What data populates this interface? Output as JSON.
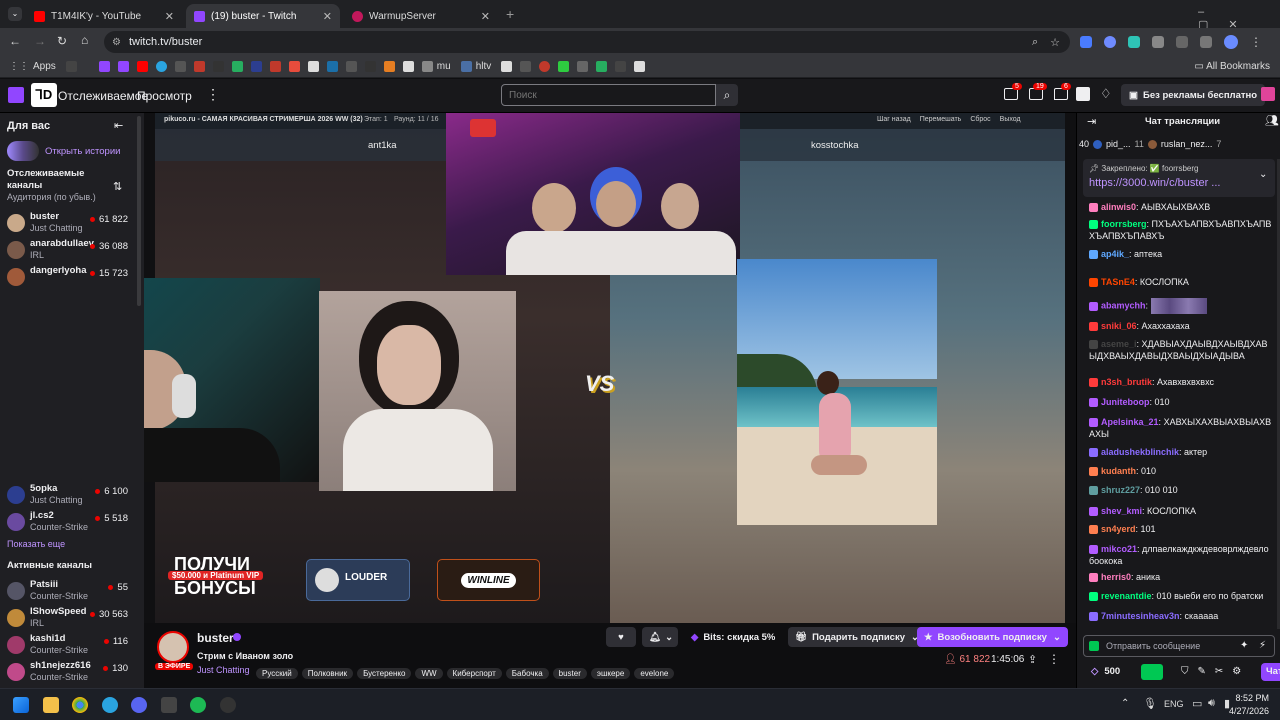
{
  "browser": {
    "tabs": [
      {
        "title": "T1M4IK'у - YouTube",
        "color": "#ff0000"
      },
      {
        "title": "(19) buster - Twitch",
        "color": "#9146ff"
      },
      {
        "title": "WarmupServer",
        "color": "#c2185b"
      }
    ],
    "url": "twitch.tv/buster",
    "bookmarks": {
      "apps": "Apps",
      "mu": "mu",
      "hltv": "hltv",
      "all": "All Bookmarks"
    }
  },
  "twitch_nav": {
    "following": "Отслеживаемое",
    "browse": "Просмотр",
    "search_placeholder": "Поиск",
    "badges": {
      "inbox": "5",
      "whispers": "19",
      "notif": "6"
    },
    "turbo": "Без рекламы бесплатно"
  },
  "sidebar": {
    "for_you": "Для вас",
    "open_stories": "Открыть истории",
    "followed_title": "Отслеживаемые каналы",
    "followed_sort": "Аудитория (по убыв.)",
    "followed": [
      {
        "name": "buster",
        "game": "Just Chatting",
        "viewers": "61 822"
      },
      {
        "name": "anarabdullaev",
        "game": "IRL",
        "viewers": "36 088"
      },
      {
        "name": "dangerlyoha",
        "game": "",
        "viewers": "15 723"
      },
      {
        "name": "5opka",
        "game": "Just Chatting",
        "viewers": "6 100"
      },
      {
        "name": "jl.cs2",
        "game": "Counter-Strike",
        "viewers": "5 518"
      }
    ],
    "show_more": "Показать еще",
    "active_title": "Активные каналы",
    "active": [
      {
        "name": "Patsiii",
        "game": "Counter-Strike",
        "viewers": "55"
      },
      {
        "name": "IShowSpeed",
        "game": "IRL",
        "viewers": "30 563"
      },
      {
        "name": "kashi1d",
        "game": "Counter-Strike",
        "viewers": "116"
      },
      {
        "name": "sh1nejezz616",
        "game": "Counter-Strike",
        "viewers": "130"
      }
    ]
  },
  "video": {
    "site_title": "pikuco.ru - САМАЯ КРАСИВАЯ СТРИМЕРША 2026 WW (32)",
    "stage": "Этап: 1",
    "round": "Раунд: 11 / 16",
    "controls": [
      "Шаг назад",
      "Перемешать",
      "Сброс",
      "Выход"
    ],
    "left_name": "ant1ka",
    "right_name": "kosstochka",
    "vs": "VS",
    "promo_line1": "ПОЛУЧИ",
    "promo_badge": "$50.000 и Platinum VIP",
    "promo_line2": "БОНУСЫ",
    "ad_louder": "LOUDER",
    "ad_winline": "WINLINE"
  },
  "stream_info": {
    "channel": "buster",
    "title": "Стрим с Иваном золо",
    "live": "В ЭФИРЕ",
    "category": "Just Chatting",
    "tags": [
      "Русский",
      "Полковник",
      "Бустеренко",
      "WW",
      "Киберспорт",
      "Бабочка",
      "buster",
      "эшкере",
      "evelone"
    ],
    "viewers": "61 822",
    "uptime": "1:45:06",
    "bits": "Bits: скидка 5%",
    "subscribe": "Подарить подписку",
    "resub": "Возобновить подписку"
  },
  "chat": {
    "header": "Чат трансляции",
    "top_count": "40",
    "gifters": [
      {
        "name": "pid_...",
        "count": "11"
      },
      {
        "name": "ruslan_nez...",
        "count": "7"
      }
    ],
    "pinned_label": "Закреплено: ✅ foorrsberg",
    "pinned_link": "https://3000.win/c/buster ...",
    "messages": [
      {
        "user": "alinwis0",
        "color": "#ff7fbf",
        "text": "АЫВХАЫХВАХВ"
      },
      {
        "user": "foorrsberg",
        "color": "#00ff7f",
        "text": "ПХЪАХЪАПВХЪАВПХЪАПВХЪАПВХЪПАВХЪ"
      },
      {
        "user": "ap4ik_",
        "color": "#5fa8ff",
        "text": "аптека"
      },
      {
        "user": "TASnE4",
        "color": "#ff4500",
        "text": "КОСЛОПКА"
      },
      {
        "user": "abamychh",
        "color": "#b25cff",
        "text": ""
      },
      {
        "user": "sniki_06",
        "color": "#ff3b3b",
        "text": "Ахаххахаха"
      },
      {
        "user": "aseme_i",
        "color": "#444444",
        "text": "ХДАВЫАХДАЫВДХАЫВДХАВЫДХВАЫХДАВЫДХВАЫДХЫАДЫВА"
      },
      {
        "user": "n3sh_brutik",
        "color": "#ff3b3b",
        "text": "Ахавхвхвхвхс"
      },
      {
        "user": "Juniteboop",
        "color": "#b25cff",
        "text": "010"
      },
      {
        "user": "Apelsinka_21",
        "color": "#b25cff",
        "text": "ХАВХЫХАХВЫАХВЫАХВАХЫ"
      },
      {
        "user": "aladushekblinchik",
        "color": "#8a6cff",
        "text": "актер"
      },
      {
        "user": "kudanth",
        "color": "#ff7f50",
        "text": "010"
      },
      {
        "user": "shruz227",
        "color": "#5f9ea0",
        "text": "010 010"
      },
      {
        "user": "shev_kmi",
        "color": "#b25cff",
        "text": "КОСЛОПКА"
      },
      {
        "user": "sn4yerd",
        "color": "#ff7f50",
        "text": "101"
      },
      {
        "user": "mikco21",
        "color": "#b25cff",
        "text": "длпаелкаждкждевоврлждевлобоокока"
      },
      {
        "user": "herris0",
        "color": "#ff7fbf",
        "text": "аника"
      },
      {
        "user": "revenantdie",
        "color": "#00ff7f",
        "text": "010 выеби его по братски"
      },
      {
        "user": "7minutesinheav3n",
        "color": "#8a6cff",
        "text": "скааааа"
      }
    ],
    "input_placeholder": "Отправить сообщение",
    "points": "500",
    "chat_button": "Чат"
  },
  "taskbar": {
    "lang": "ENG",
    "time": "8:52 PM",
    "date": "4/27/2026"
  }
}
